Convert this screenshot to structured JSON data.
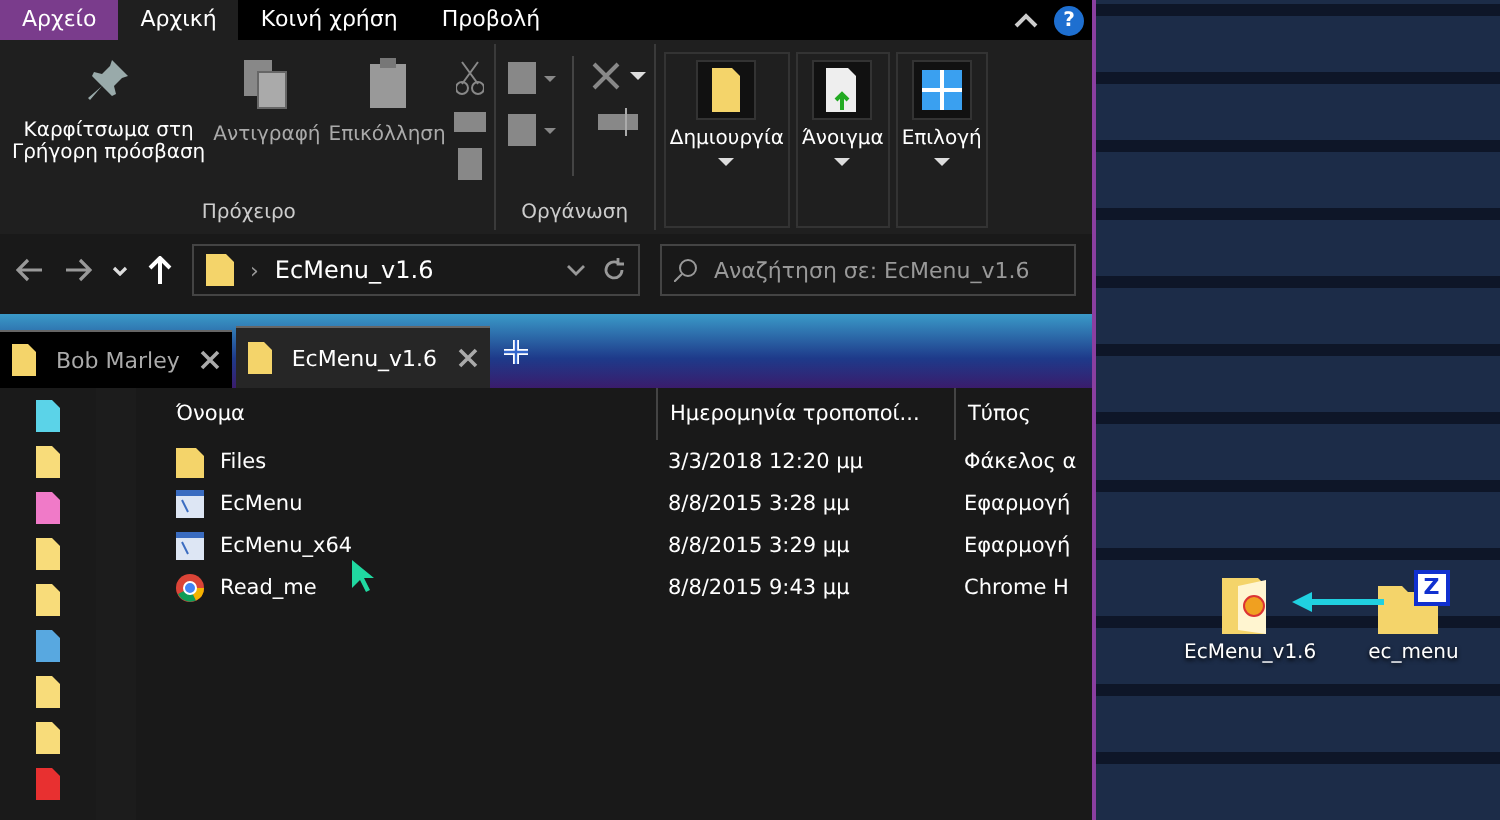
{
  "ribbon_tabs": [
    {
      "label": "Αρχείο",
      "kind": "file",
      "selected": false
    },
    {
      "label": "Αρχική",
      "kind": "tab",
      "selected": true
    },
    {
      "label": "Κοινή χρήση",
      "kind": "tab",
      "selected": false
    },
    {
      "label": "Προβολή",
      "kind": "tab",
      "selected": false
    }
  ],
  "help": "?",
  "clipboard": {
    "pin": "Καρφίτσωμα στη\nΓρήγορη πρόσβαση",
    "copy": "Αντιγραφή",
    "paste": "Επικόλληση",
    "group": "Πρόχειρο"
  },
  "organize": {
    "group": "Οργάνωση"
  },
  "big_buttons": [
    {
      "label": "Δημιουργία",
      "kind": "new"
    },
    {
      "label": "Άνοιγμα",
      "kind": "open"
    },
    {
      "label": "Επιλογή",
      "kind": "select"
    }
  ],
  "address": {
    "separator": "›",
    "path": "EcMenu_v1.6",
    "search_placeholder": "Αναζήτηση σε: EcMenu_v1.6"
  },
  "tabs": [
    {
      "label": "Bob Marley",
      "selected": false
    },
    {
      "label": "EcMenu_v1.6",
      "selected": true
    }
  ],
  "nav_items": [
    {
      "color": "#5bd3e8"
    },
    {
      "color": "#f8dc7a"
    },
    {
      "color": "#f07ac8"
    },
    {
      "color": "#f8dc7a"
    },
    {
      "color": "#f8dc7a"
    },
    {
      "color": "#58a8e0"
    },
    {
      "color": "#f8dc7a"
    },
    {
      "color": "#f8dc7a"
    },
    {
      "color": "#e83030"
    }
  ],
  "table": {
    "columns": [
      "Όνομα",
      "Ημερομηνία τροποποί...",
      "Τύπος"
    ],
    "rows": [
      {
        "kind": "folder",
        "name": "Files",
        "date": "3/3/2018 12:20 μμ",
        "type": "Φάκελος α"
      },
      {
        "kind": "app",
        "name": "EcMenu",
        "date": "8/8/2015 3:28 μμ",
        "type": "Εφαρμογή"
      },
      {
        "kind": "app",
        "name": "EcMenu_x64",
        "date": "8/8/2015 3:29 μμ",
        "type": "Εφαρμογή"
      },
      {
        "kind": "chrome",
        "name": "Read_me",
        "date": "8/8/2015 9:43 μμ",
        "type": "Chrome H"
      }
    ]
  },
  "desktop_icons": [
    {
      "label": "EcMenu_v1.6",
      "kind": "folder-open"
    },
    {
      "label": "ec_menu",
      "kind": "zip",
      "badge": "Z"
    }
  ]
}
